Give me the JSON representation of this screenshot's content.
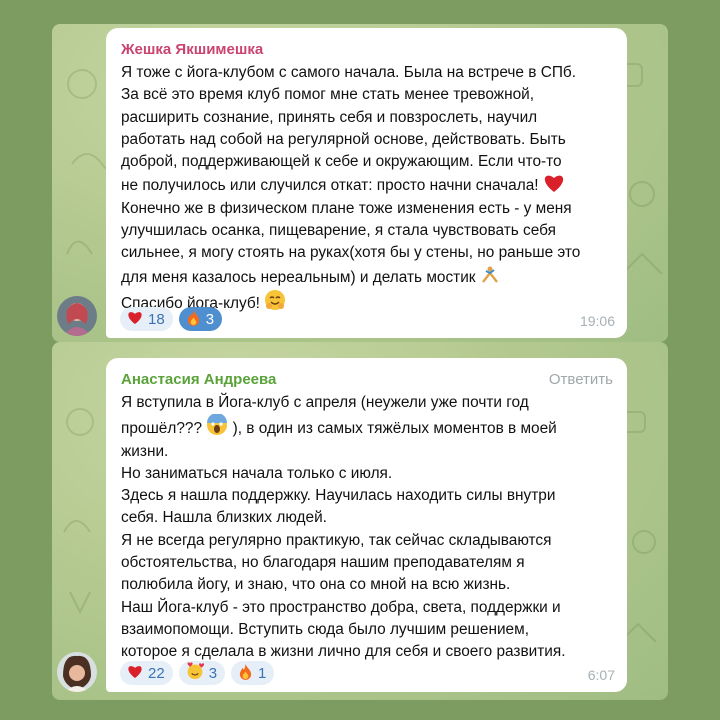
{
  "messages": [
    {
      "author": "Жешка Якшимешка",
      "reply_label": "",
      "lines": [
        "Я тоже с йога-клубом с самого начала. Была на встрече в СПб.",
        "За всё это время клуб помог мне стать менее тревожной,",
        "расширить сознание, принять себя и повзрослеть, научил",
        "работать над собой на регулярной основе, действовать. Быть",
        "доброй, поддерживающей к себе и окружающим. Если что-то",
        "не получилось или случился откат: просто начни сначала!",
        "Конечно же в физическом плане тоже изменения есть - у меня",
        "улучшилась осанка, пищеварение, я стала чувствовать себя",
        "сильнее, я могу стоять на руках(хотя бы у стены, но раньше это",
        "для меня казалось нереальным) и делать мостик",
        "Спасибо йога-клуб!"
      ],
      "reactions": [
        {
          "icon": "heart-icon",
          "count": "18",
          "selected": false
        },
        {
          "icon": "fire-icon",
          "count": "3",
          "selected": true
        }
      ],
      "time": "19:06"
    },
    {
      "author": "Анастасия Андреева",
      "reply_label": "Ответить",
      "lines": [
        "Я вступила в Йога-клуб с апреля (неужели уже почти год",
        "прошёл???",
        "), в один из самых тяжёлых моментов в моей",
        "жизни.",
        "Но заниматься начала только с июля.",
        "Здесь я нашла поддержку. Научилась находить силы внутри",
        "себя. Нашла близких людей.",
        "Я не всегда регулярно практикую, так сейчас складываются",
        "обстоятельства, но благодаря нашим преподавателям я",
        "полюбила йогу, и знаю, что она со мной на всю жизнь.",
        "Наш Йога-клуб - это пространство добра, света, поддержки и",
        "взаимопомощи. Вступить сюда было лучшим решением,",
        "которое я сделала в жизни лично для себя и своего развития."
      ],
      "reactions": [
        {
          "icon": "heart-icon",
          "count": "22",
          "selected": false
        },
        {
          "icon": "smiling-hearts-icon",
          "count": "3",
          "selected": false
        },
        {
          "icon": "fire-icon",
          "count": "1",
          "selected": false
        }
      ],
      "time": "6:07"
    }
  ],
  "colors": {
    "frame": "#7c9c61",
    "author1": "#c9446f",
    "author2": "#5aa33a",
    "reaction_bg": "#e6eef7",
    "reaction_selected": "#4f8fd0"
  }
}
